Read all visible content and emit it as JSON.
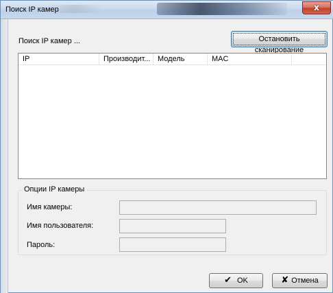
{
  "window": {
    "title": "Поиск IP камер",
    "close_glyph": "x"
  },
  "scan": {
    "status_text": "Поиск IP камер ...",
    "stop_button_label": "Остановить сканирование"
  },
  "list": {
    "columns": [
      "IP",
      "Производит...",
      "Модель",
      "MAC",
      ""
    ],
    "rows": []
  },
  "options": {
    "group_title": "Опции IP камеры",
    "camera_name_label": "Имя камеры:",
    "camera_name_value": "",
    "username_label": "Имя пользователя:",
    "username_value": "",
    "password_label": "Пароль:",
    "password_value": ""
  },
  "footer": {
    "ok_label": "OK",
    "ok_icon": "checkmark-icon",
    "cancel_label": "Отмена",
    "cancel_icon": "cross-icon"
  },
  "colors": {
    "close_button": "#c94a33",
    "window_bg": "#f0f0f0",
    "focus_border": "#3c7fb1"
  }
}
